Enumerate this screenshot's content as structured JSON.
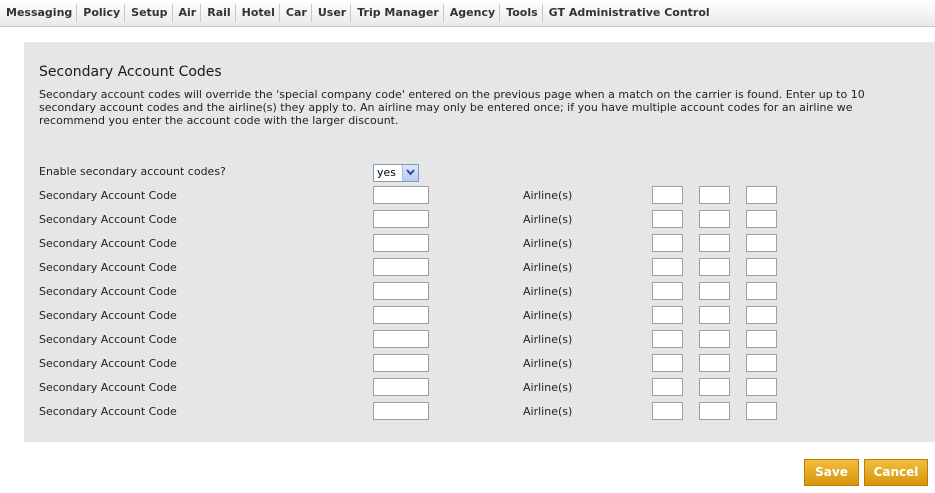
{
  "nav": {
    "items": [
      "Messaging",
      "Policy",
      "Setup",
      "Air",
      "Rail",
      "Hotel",
      "Car",
      "User",
      "Trip Manager",
      "Agency",
      "Tools",
      "GT Administrative Control"
    ]
  },
  "page": {
    "title": "Secondary Account Codes",
    "description": "Secondary account codes will override the 'special company code' entered on the previous page when a match on the carrier is found. Enter up to 10 secondary account codes and the airline(s) they apply to. An airline may only be entered once; if you have multiple account codes for an airline we recommend you enter the account code with the larger discount."
  },
  "enable": {
    "label": "Enable secondary account codes?",
    "value": "yes"
  },
  "rows": [
    {
      "label": "Secondary Account Code",
      "airline_label": "Airline(s)",
      "code": "",
      "airlines": [
        "",
        "",
        ""
      ]
    },
    {
      "label": "Secondary Account Code",
      "airline_label": "Airline(s)",
      "code": "",
      "airlines": [
        "",
        "",
        ""
      ]
    },
    {
      "label": "Secondary Account Code",
      "airline_label": "Airline(s)",
      "code": "",
      "airlines": [
        "",
        "",
        ""
      ]
    },
    {
      "label": "Secondary Account Code",
      "airline_label": "Airline(s)",
      "code": "",
      "airlines": [
        "",
        "",
        ""
      ]
    },
    {
      "label": "Secondary Account Code",
      "airline_label": "Airline(s)",
      "code": "",
      "airlines": [
        "",
        "",
        ""
      ]
    },
    {
      "label": "Secondary Account Code",
      "airline_label": "Airline(s)",
      "code": "",
      "airlines": [
        "",
        "",
        ""
      ]
    },
    {
      "label": "Secondary Account Code",
      "airline_label": "Airline(s)",
      "code": "",
      "airlines": [
        "",
        "",
        ""
      ]
    },
    {
      "label": "Secondary Account Code",
      "airline_label": "Airline(s)",
      "code": "",
      "airlines": [
        "",
        "",
        ""
      ]
    },
    {
      "label": "Secondary Account Code",
      "airline_label": "Airline(s)",
      "code": "",
      "airlines": [
        "",
        "",
        ""
      ]
    },
    {
      "label": "Secondary Account Code",
      "airline_label": "Airline(s)",
      "code": "",
      "airlines": [
        "",
        "",
        ""
      ]
    }
  ],
  "buttons": {
    "save": "Save",
    "cancel": "Cancel"
  }
}
